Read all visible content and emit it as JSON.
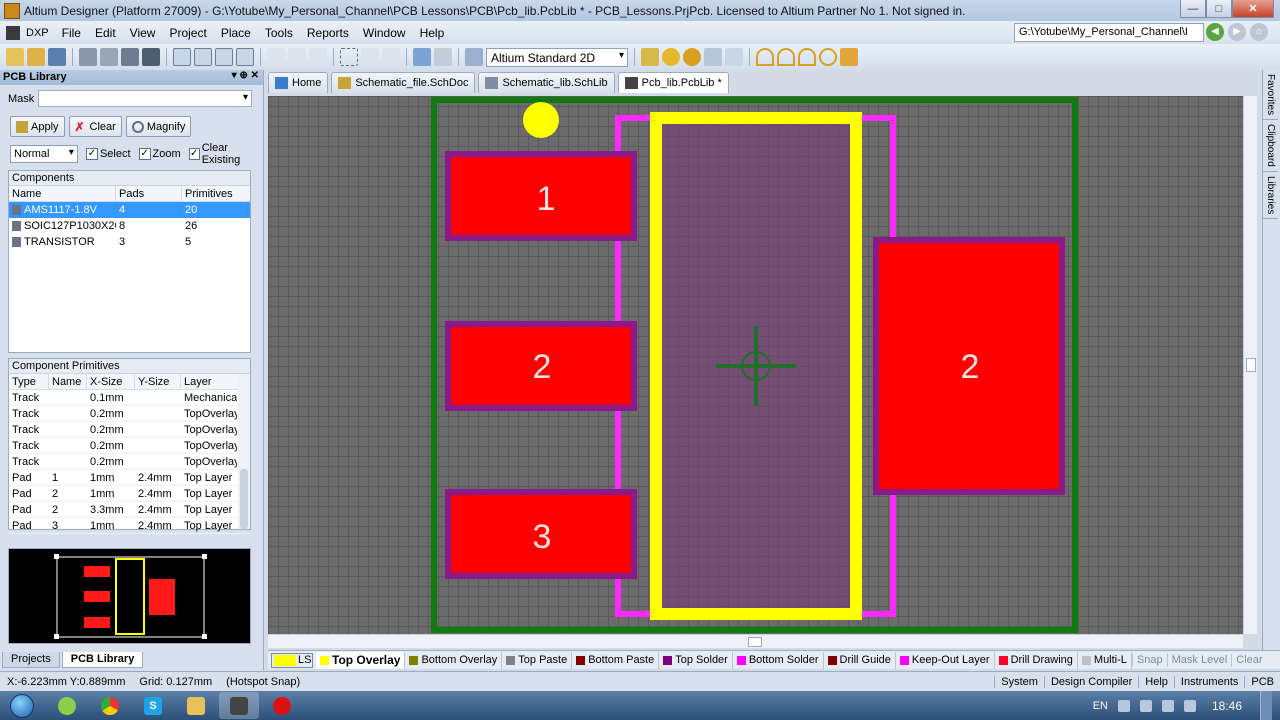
{
  "window": {
    "title": "Altium Designer (Platform 27009) - G:\\Yotube\\My_Personal_Channel\\PCB Lessons\\PCB\\Pcb_lib.PcbLib * - PCB_Lessons.PrjPcb. Licensed to Altium Partner No 1. Not signed in.",
    "min": "—",
    "max": "□",
    "close": "✕"
  },
  "menu": {
    "dxp": "DXP",
    "items": [
      "File",
      "Edit",
      "View",
      "Project",
      "Place",
      "Tools",
      "Reports",
      "Window",
      "Help"
    ],
    "path": "G:\\Yotube\\My_Personal_Channel\\I"
  },
  "toolbar": {
    "view_mode": "Altium Standard 2D"
  },
  "panel": {
    "title": "PCB Library",
    "mask_label": "Mask",
    "apply": "Apply",
    "clear": "Clear",
    "magnify": "Magnify",
    "mode": "Normal",
    "select": "Select",
    "zoom": "Zoom",
    "clear_existing": "Clear Existing",
    "components_title": "Components",
    "components_headers": [
      "Name",
      "Pads",
      "Primitives"
    ],
    "components": [
      {
        "name": "AMS1117-1.8V",
        "pads": "4",
        "primitives": "20"
      },
      {
        "name": "SOIC127P1030X26",
        "pads": "8",
        "primitives": "26"
      },
      {
        "name": "TRANSISTOR",
        "pads": "3",
        "primitives": "5"
      }
    ],
    "primitives_title": "Component Primitives",
    "primitives_headers": [
      "Type",
      "Name",
      "X-Size",
      "Y-Size",
      "Layer"
    ],
    "primitives": [
      {
        "type": "Track",
        "name": "",
        "x": "0.1mm",
        "y": "",
        "layer": "Mechanica"
      },
      {
        "type": "Track",
        "name": "",
        "x": "0.2mm",
        "y": "",
        "layer": "TopOverlay"
      },
      {
        "type": "Track",
        "name": "",
        "x": "0.2mm",
        "y": "",
        "layer": "TopOverlay"
      },
      {
        "type": "Track",
        "name": "",
        "x": "0.2mm",
        "y": "",
        "layer": "TopOverlay"
      },
      {
        "type": "Track",
        "name": "",
        "x": "0.2mm",
        "y": "",
        "layer": "TopOverlay"
      },
      {
        "type": "Pad",
        "name": "1",
        "x": "1mm",
        "y": "2.4mm",
        "layer": "Top Layer"
      },
      {
        "type": "Pad",
        "name": "2",
        "x": "1mm",
        "y": "2.4mm",
        "layer": "Top Layer"
      },
      {
        "type": "Pad",
        "name": "2",
        "x": "3.3mm",
        "y": "2.4mm",
        "layer": "Top Layer"
      },
      {
        "type": "Pad",
        "name": "3",
        "x": "1mm",
        "y": "2.4mm",
        "layer": "Top Layer"
      }
    ],
    "tabs": [
      "Projects",
      "PCB Library"
    ]
  },
  "doc_tabs": [
    {
      "label": "Home",
      "active": false
    },
    {
      "label": "Schematic_file.SchDoc",
      "active": false
    },
    {
      "label": "Schematic_lib.SchLib",
      "active": false
    },
    {
      "label": "Pcb_lib.PcbLib *",
      "active": true
    }
  ],
  "pads": [
    "1",
    "2",
    "3",
    "2"
  ],
  "right_sidebar": [
    "Favorites",
    "Clipboard",
    "Libraries"
  ],
  "layers": {
    "ls": "LS",
    "items": [
      {
        "label": "Top Overlay",
        "color": "#ffff00",
        "active": true
      },
      {
        "label": "Bottom Overlay",
        "color": "#808000",
        "active": false
      },
      {
        "label": "Top Paste",
        "color": "#808080",
        "active": false
      },
      {
        "label": "Bottom Paste",
        "color": "#800000",
        "active": false
      },
      {
        "label": "Top Solder",
        "color": "#800080",
        "active": false
      },
      {
        "label": "Bottom Solder",
        "color": "#ff00ff",
        "active": false
      },
      {
        "label": "Drill Guide",
        "color": "#800000",
        "active": false
      },
      {
        "label": "Keep-Out Layer",
        "color": "#ff00ff",
        "active": false
      },
      {
        "label": "Drill Drawing",
        "color": "#ff002a",
        "active": false
      },
      {
        "label": "Multi-L",
        "color": "#c0c0c0",
        "active": false
      }
    ],
    "snap": "Snap",
    "mask_level": "Mask Level",
    "clear": "Clear"
  },
  "status": {
    "coords": "X:-6.223mm Y:0.889mm",
    "grid": "Grid: 0.127mm",
    "snap": "(Hotspot Snap)",
    "right": [
      "System",
      "Design Compiler",
      "Help",
      "Instruments",
      "PCB"
    ]
  },
  "taskbar": {
    "lang": "EN",
    "time": "18:46"
  }
}
